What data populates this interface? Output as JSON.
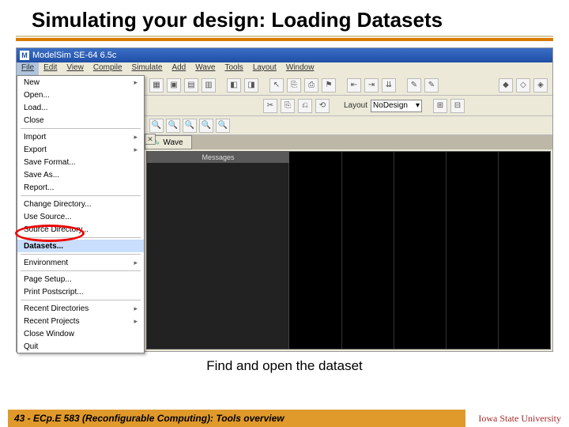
{
  "title": "Simulating your design: Loading Datasets",
  "app_title": "ModelSim SE-64 6.5c",
  "menubar": [
    "File",
    "Edit",
    "View",
    "Compile",
    "Simulate",
    "Add",
    "Wave",
    "Tools",
    "Layout",
    "Window"
  ],
  "file_menu": {
    "g1": [
      "New",
      "Open...",
      "Load...",
      "Close"
    ],
    "g2": [
      "Import",
      "Export",
      "Save Format...",
      "Save As...",
      "Report..."
    ],
    "g3": [
      "Change Directory...",
      "Use Source...",
      "Source Directory..."
    ],
    "g4": [
      "Datasets..."
    ],
    "g5": [
      "Environment"
    ],
    "g6": [
      "Page Setup...",
      "Print Postscript..."
    ],
    "g7": [
      "Recent Directories",
      "Recent Projects",
      "Close Window",
      "Quit"
    ]
  },
  "layout_label": "Layout",
  "layout_value": "NoDesign",
  "wave_tab": "Wave",
  "wave_messages": "Messages",
  "caption": "Find and open the dataset",
  "footer_left": "43 - ECp.E 583 (Reconfigurable Computing): Tools overview",
  "footer_right": "Iowa State University"
}
